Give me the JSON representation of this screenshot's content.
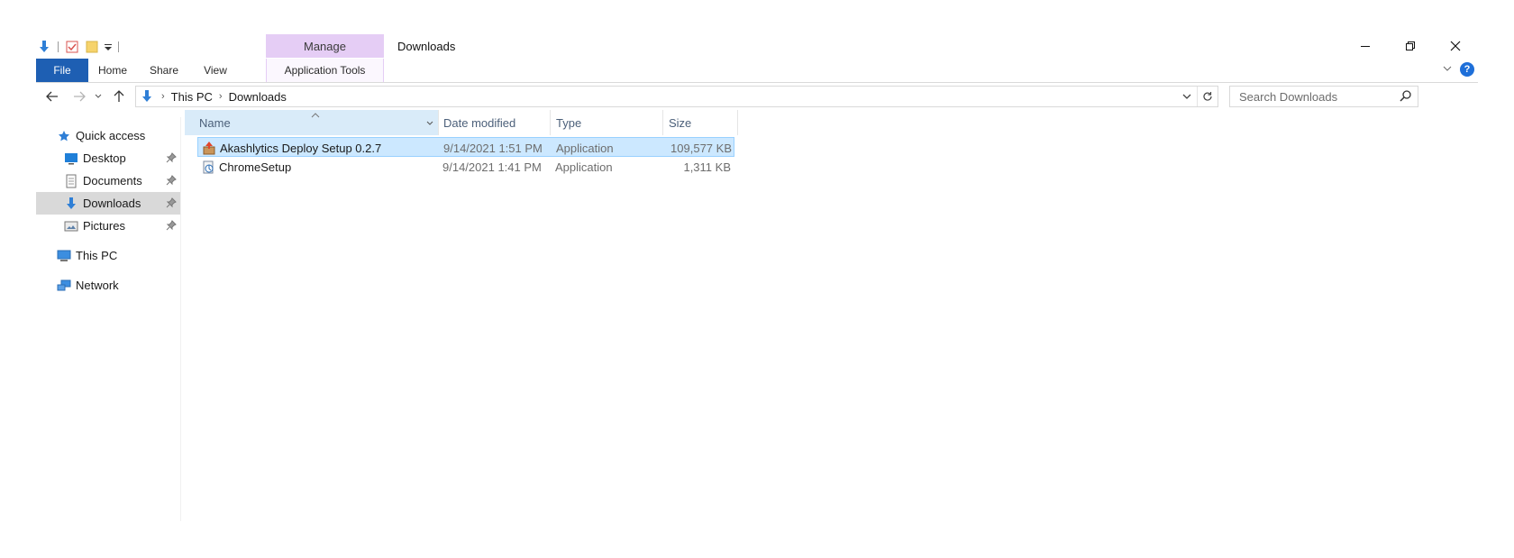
{
  "titlebar": {
    "title": "Downloads",
    "contextual_tab_group": "Manage",
    "controls": {
      "minimize": "minimize-icon",
      "restore": "restore-icon",
      "close": "close-icon"
    }
  },
  "ribbon": {
    "tabs": [
      {
        "label": "File"
      },
      {
        "label": "Home"
      },
      {
        "label": "Share"
      },
      {
        "label": "View"
      },
      {
        "label": "Application Tools"
      }
    ],
    "help": "?"
  },
  "address": {
    "crumbs": [
      "This PC",
      "Downloads"
    ]
  },
  "search": {
    "placeholder": "Search Downloads"
  },
  "navigation": {
    "items": [
      {
        "label": "Quick access",
        "icon": "star-icon"
      },
      {
        "label": "Desktop",
        "icon": "desktop-icon",
        "pinned": true
      },
      {
        "label": "Documents",
        "icon": "documents-icon",
        "pinned": true
      },
      {
        "label": "Downloads",
        "icon": "downloads-icon",
        "pinned": true,
        "selected": true
      },
      {
        "label": "Pictures",
        "icon": "pictures-icon",
        "pinned": true
      },
      {
        "label": "This PC",
        "icon": "computer-icon"
      },
      {
        "label": "Network",
        "icon": "network-icon"
      }
    ]
  },
  "filelist": {
    "columns": [
      "Name",
      "Date modified",
      "Type",
      "Size"
    ],
    "rows": [
      {
        "name": "Akashlytics Deploy Setup 0.2.7",
        "date": "9/14/2021 1:51 PM",
        "type": "Application",
        "size": "109,577 KB",
        "selected": true
      },
      {
        "name": "ChromeSetup",
        "date": "9/14/2021 1:41 PM",
        "type": "Application",
        "size": "1,311 KB",
        "selected": false
      }
    ]
  },
  "colors": {
    "file_tab": "#1e5fb3",
    "manage_tab": "#e5cdf5",
    "selection": "#cce8ff",
    "nav_selected": "#d9d9d9"
  }
}
